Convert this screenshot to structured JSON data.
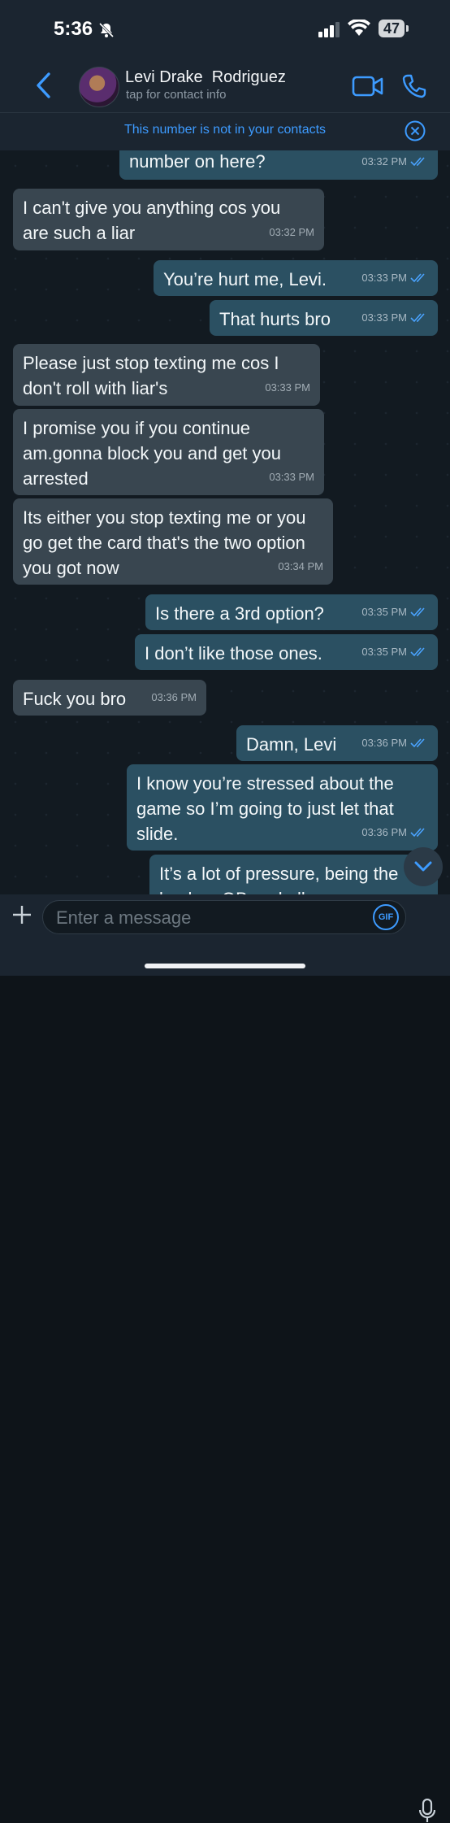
{
  "status": {
    "time": "5:36",
    "battery": "47"
  },
  "header": {
    "contact_name": "Levi Drake  Rodriguez",
    "contact_sub": "tap for contact info"
  },
  "banner": {
    "text": "This number is not in your contacts"
  },
  "messages": [
    {
      "dir": "out",
      "text": "number on here?",
      "time": "03:32 PM"
    },
    {
      "dir": "in",
      "text": "I can't give you anything cos you are such a liar",
      "time": "03:32 PM"
    },
    {
      "dir": "out",
      "text": "You’re hurt me, Levi.",
      "time": "03:33 PM"
    },
    {
      "dir": "out",
      "text": "That hurts bro",
      "time": "03:33 PM"
    },
    {
      "dir": "in",
      "text": "Please just stop texting me cos I don't roll with liar's",
      "time": "03:33 PM"
    },
    {
      "dir": "in",
      "text": "I promise you if you continue am.gonna block you and get you arrested",
      "time": "03:33 PM"
    },
    {
      "dir": "in",
      "text": "Its either you stop texting me or you go get the card that's the two option you got now",
      "time": "03:34 PM"
    },
    {
      "dir": "out",
      "text": "Is there a 3rd option?",
      "time": "03:35 PM"
    },
    {
      "dir": "out",
      "text": "I don’t like those ones.",
      "time": "03:35 PM"
    },
    {
      "dir": "in",
      "text": "Fuck you bro",
      "time": "03:36 PM"
    },
    {
      "dir": "out",
      "text": "Damn, Levi",
      "time": "03:36 PM"
    },
    {
      "dir": "out",
      "text": "I know you’re stressed about the game so I’m going to just let that slide.",
      "time": "03:36 PM"
    },
    {
      "dir": "out",
      "text": "It’s a lot of pressure, being the backup QB and all",
      "time": ""
    }
  ],
  "composer": {
    "placeholder": "Enter a message",
    "gif_label": "GIF"
  },
  "colors": {
    "accent": "#3d9bff",
    "outgoing": "#2b5062",
    "incoming": "#394650",
    "tick": "#4aa3ff"
  }
}
